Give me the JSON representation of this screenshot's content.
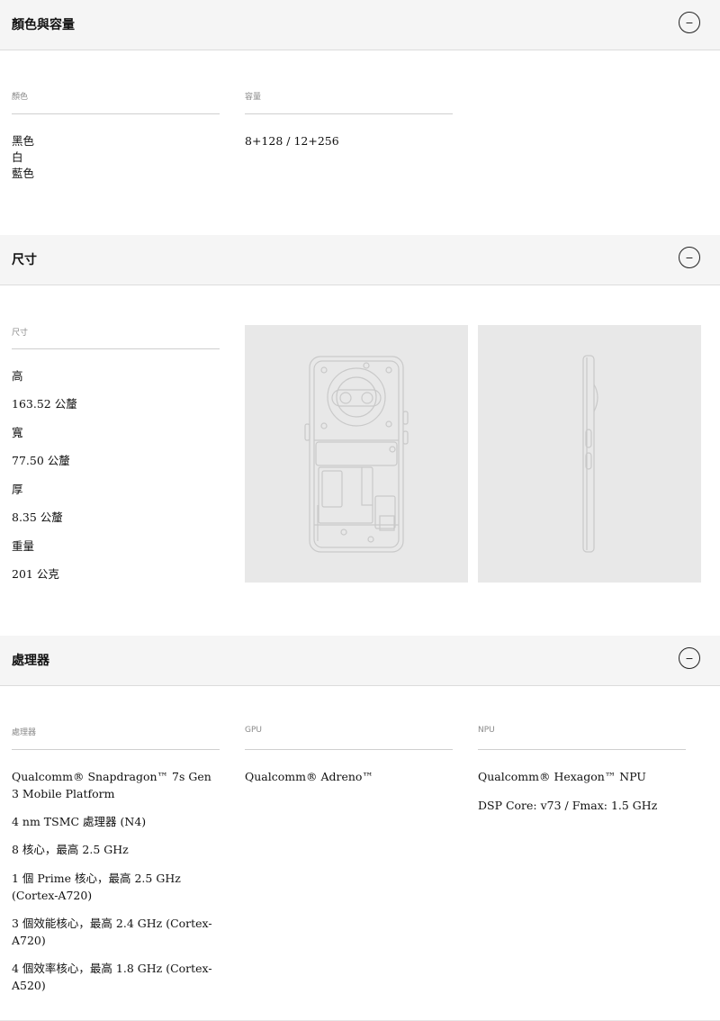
{
  "colors_section": {
    "title": "顏色與容量",
    "toggle": "−",
    "color_label": "顏色",
    "color_values": [
      "黑色",
      "白",
      "藍色"
    ],
    "capacity_label": "容量",
    "capacity_value": "8+128 / 12+256"
  },
  "dimensions_section": {
    "title": "尺寸",
    "toggle": "−",
    "label": "尺寸",
    "items": [
      {
        "name": "高",
        "value": "163.52 公釐"
      },
      {
        "name": "寬",
        "value": "77.50 公釐"
      },
      {
        "name": "厚",
        "value": "8.35 公釐"
      },
      {
        "name": "重量",
        "value": "201 公克"
      }
    ],
    "images": [
      "phone-back-outline",
      "phone-side-outline"
    ]
  },
  "processor_section": {
    "title": "處理器",
    "toggle": "−",
    "cpu_label": "處理器",
    "cpu_values": [
      "Qualcomm® Snapdragon™ 7s Gen 3 Mobile Platform",
      "4 nm TSMC 處理器 (N4)",
      "8 核心，最高 2.5 GHz",
      "1 個 Prime 核心，最高 2.5 GHz (Cortex-A720)",
      "3 個效能核心，最高 2.4 GHz (Cortex-A720)",
      "4 個效率核心，最高 1.8 GHz (Cortex-A520)"
    ],
    "gpu_label": "GPU",
    "gpu_value": "Qualcomm® Adreno™",
    "npu_label": "NPU",
    "npu_values": [
      "Qualcomm® Hexagon™ NPU",
      "DSP Core: v73 / Fmax: 1.5 GHz"
    ]
  }
}
